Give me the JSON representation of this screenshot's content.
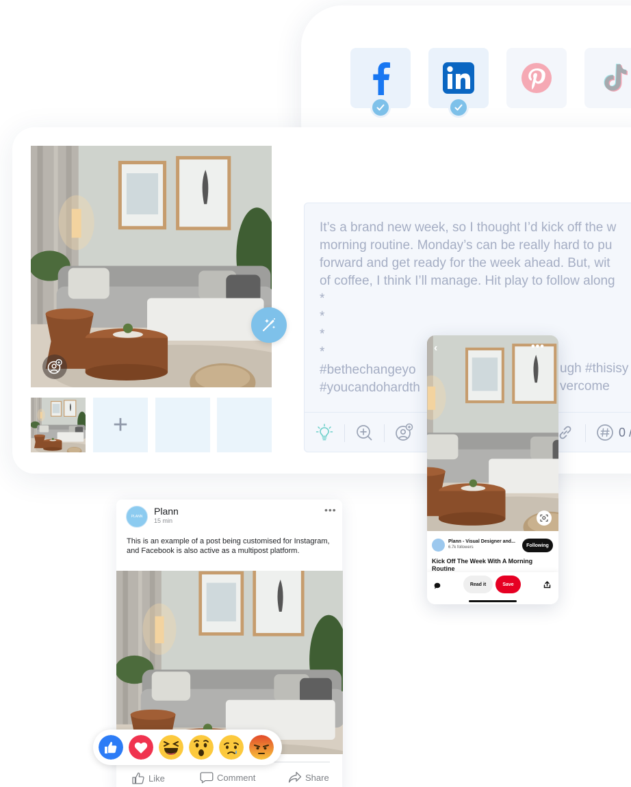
{
  "platforms": [
    {
      "name": "facebook",
      "icon": "facebook-icon",
      "selected": true,
      "color": "#1877f2"
    },
    {
      "name": "linkedin",
      "icon": "linkedin-icon",
      "selected": true,
      "color": "#0a66c2"
    },
    {
      "name": "pinterest",
      "icon": "pinterest-icon",
      "selected": false,
      "color": "#f5a9b4"
    },
    {
      "name": "tiktok",
      "icon": "tiktok-icon",
      "selected": false,
      "color": "#9aa0a8"
    }
  ],
  "editor": {
    "caption_lines": [
      "It’s a brand new week, so I thought I’d kick off the w",
      "morning routine. Monday’s can be really hard to pu",
      "forward and get ready for the week ahead. But, wit",
      "of coffee, I think I’ll manage. Hit play to follow along",
      "*",
      "*",
      "*",
      "*",
      "#bethechangeyo",
      "#youcandohardth"
    ],
    "caption_overflow": [
      "ugh #thisisy",
      "vercome"
    ],
    "hashtag_count": "0 /",
    "add_media_symbol": "+",
    "tools": [
      "lightbulb-icon",
      "zoom-in-icon",
      "tag-user-icon",
      "link-icon",
      "hashtag-icon"
    ]
  },
  "facebook_preview": {
    "account_name": "Plann",
    "avatar_text": "PLANN",
    "time": "15 min",
    "more": "•••",
    "text": "This is an example of a post being customised for Instagram, and Facebook is also active as a multipost platform.",
    "reactions": [
      "like",
      "love",
      "haha",
      "wow",
      "sad",
      "angry"
    ],
    "actions": {
      "like": "Like",
      "comment": "Comment",
      "share": "Share"
    }
  },
  "pinterest_preview": {
    "back": "‹",
    "more": "•••",
    "author": "Plann - Visual Designer and...",
    "followers": "6.7k followers",
    "follow_label": "Following",
    "title": "Kick Off The Week With A Morning Routine",
    "read_label": "Read it",
    "save_label": "Save"
  }
}
